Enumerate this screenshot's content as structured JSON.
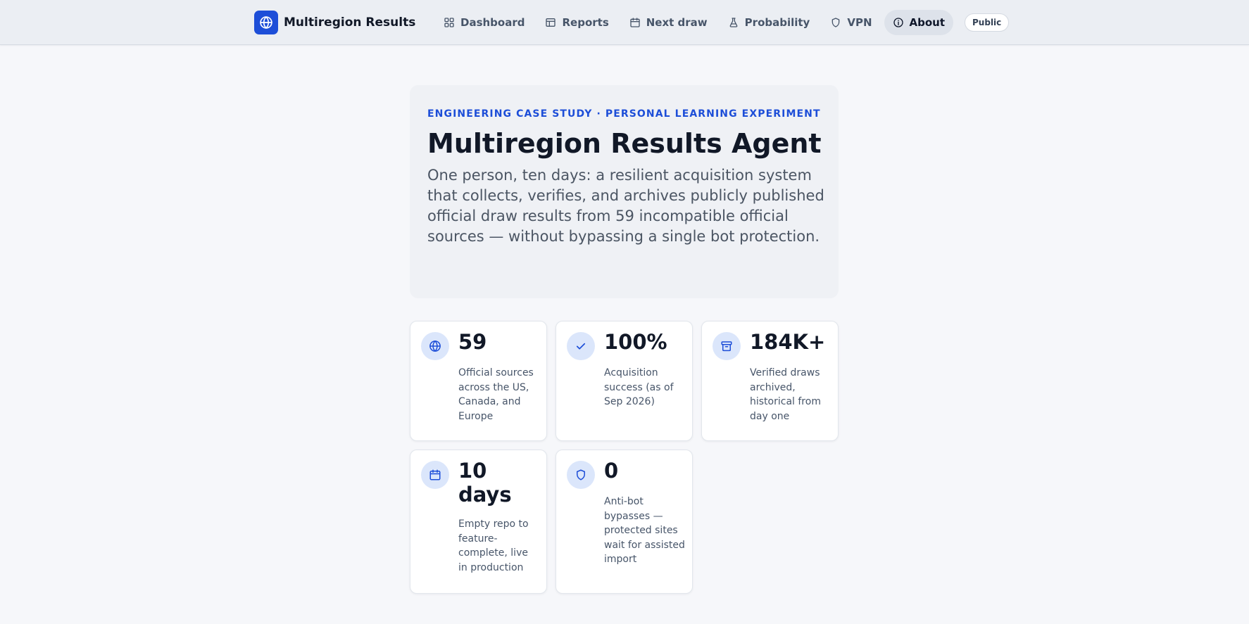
{
  "header": {
    "brand": "Multiregion Results",
    "nav": [
      {
        "label": "Dashboard",
        "icon": "grid-icon"
      },
      {
        "label": "Reports",
        "icon": "table-icon"
      },
      {
        "label": "Next draw",
        "icon": "calendar-icon"
      },
      {
        "label": "Probability",
        "icon": "flask-icon"
      },
      {
        "label": "VPN",
        "icon": "shield-icon"
      },
      {
        "label": "About",
        "icon": "info-icon",
        "active": true
      }
    ],
    "badge": "Public"
  },
  "hero": {
    "eyebrow": "ENGINEERING CASE STUDY · PERSONAL LEARNING EXPERIMENT",
    "title": "Multiregion Results Agent",
    "description": "One person, ten days: a resilient acquisition system that collects, verifies, and archives publicly published official draw results from 59 incompatible official sources — without bypassing a single bot protection."
  },
  "stats": [
    {
      "value": "59",
      "label": "Official sources across the US, Canada, and Europe",
      "icon": "globe-icon"
    },
    {
      "value": "100%",
      "label": "Acquisition success (as of Sep 2026)",
      "icon": "check-icon"
    },
    {
      "value": "184K+",
      "label": "Verified draws archived, historical from day one",
      "icon": "archive-icon"
    },
    {
      "value": "10 days",
      "label": "Empty repo to feature-complete, live in production",
      "icon": "calendar-icon"
    },
    {
      "value": "0",
      "label": "Anti-bot bypasses — protected sites wait for assisted import",
      "icon": "shield-icon"
    }
  ],
  "colors": {
    "accent": "#1d4ed8",
    "background": "#f6f7fa",
    "topbar": "#ebeef3",
    "icon_bg": "#dbe6fb"
  }
}
